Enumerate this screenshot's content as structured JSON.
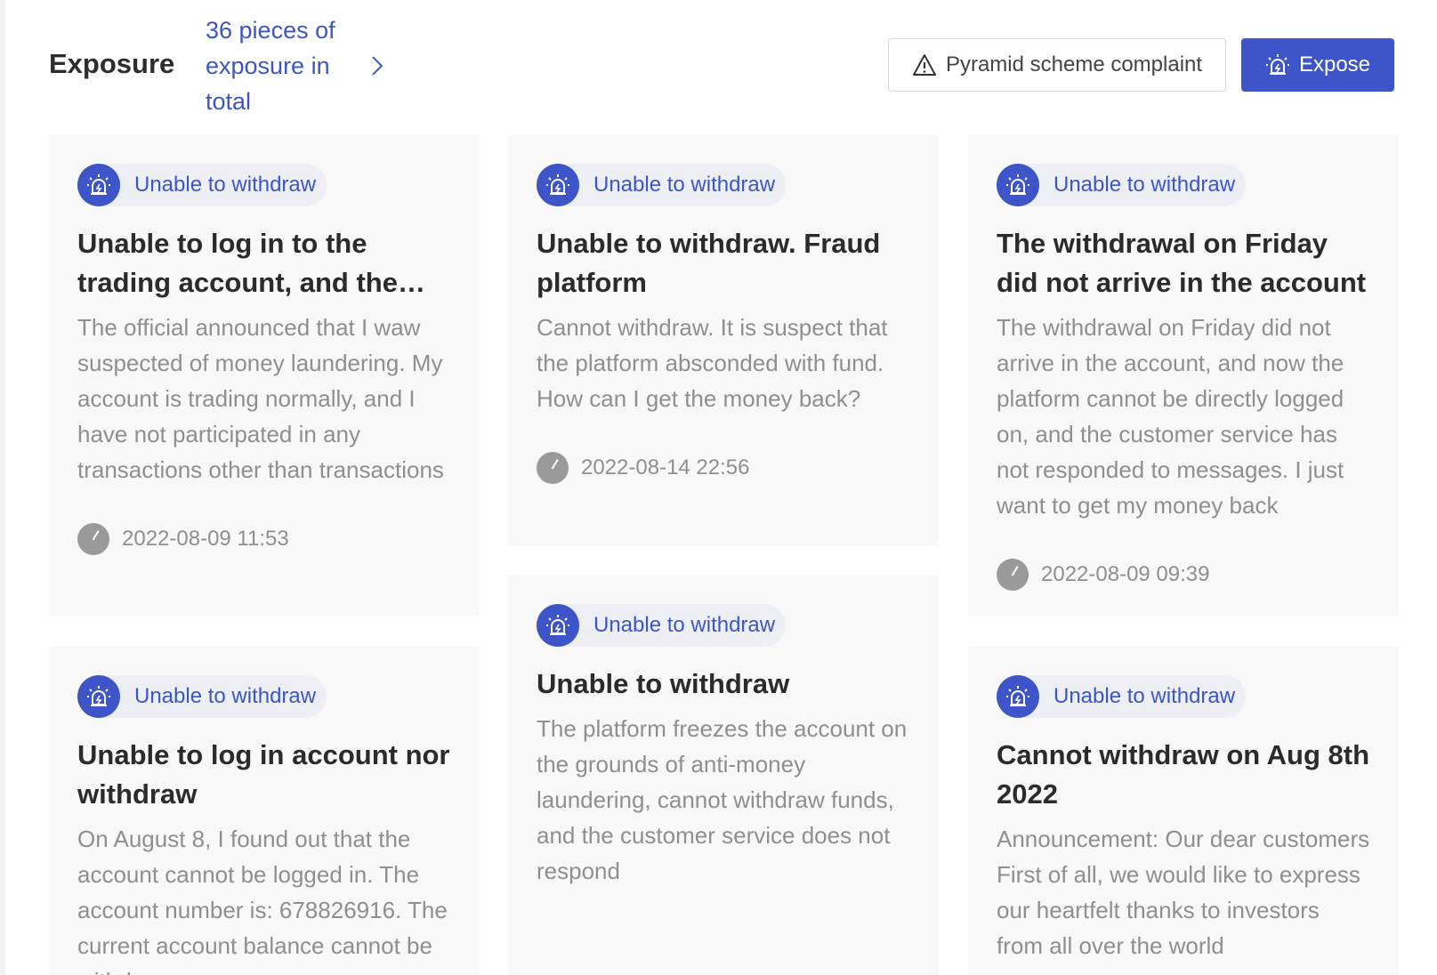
{
  "header": {
    "title": "Exposure",
    "count_text": "36 pieces of exposure in total",
    "complaint_label": "Pyramid scheme complaint",
    "expose_label": "Expose"
  },
  "colors": {
    "accent": "#3d55c8",
    "link": "#3b56c9",
    "card_bg": "#f8f8f8",
    "muted_text": "#8f8f8f"
  },
  "icons": {
    "tag": "alarm-siren-icon",
    "time": "clock-icon",
    "complaint": "warning-triangle-icon",
    "expose": "alarm-siren-icon",
    "more": "chevron-right-icon"
  },
  "cards": [
    {
      "tag": "Unable to withdraw",
      "title": "Unable to log in to the trading account, and the official announced that I was suspected of money laundering",
      "description": "The official announced that I waw suspected of money laundering. My account is trading normally, and I have not participated in any transactions other than transactions",
      "time": "2022-08-09 11:53"
    },
    {
      "tag": "Unable to withdraw",
      "title": "Unable to withdraw. Fraud platform",
      "description": "Cannot withdraw. It is suspect that the platform absconded with fund. How can I get the money back?",
      "time": "2022-08-14 22:56"
    },
    {
      "tag": "Unable to withdraw",
      "title": "The withdrawal on Friday did not arrive in the account",
      "description": "The withdrawal on Friday did not arrive in the account, and now the platform cannot be directly logged on, and the customer service has not responded to messages. I just want to get my money back",
      "time": "2022-08-09 09:39"
    },
    {
      "tag": "Unable to withdraw",
      "title": "Unable to log in account nor withdraw",
      "description": "On August 8, I found out that the account cannot be logged in. The account number is: 678826916. The current account balance cannot be withdrawn",
      "time": ""
    },
    {
      "tag": "Unable to withdraw",
      "title": "Unable to withdraw",
      "description": "The platform freezes the account on the grounds of anti-money laundering, cannot withdraw funds, and the customer service does not respond",
      "time": ""
    },
    {
      "tag": "Unable to withdraw",
      "title": "Cannot withdraw on Aug 8th 2022",
      "description": "Announcement: Our dear customers First of all, we would like to express our heartfelt thanks to investors from all over the world",
      "time": ""
    }
  ]
}
